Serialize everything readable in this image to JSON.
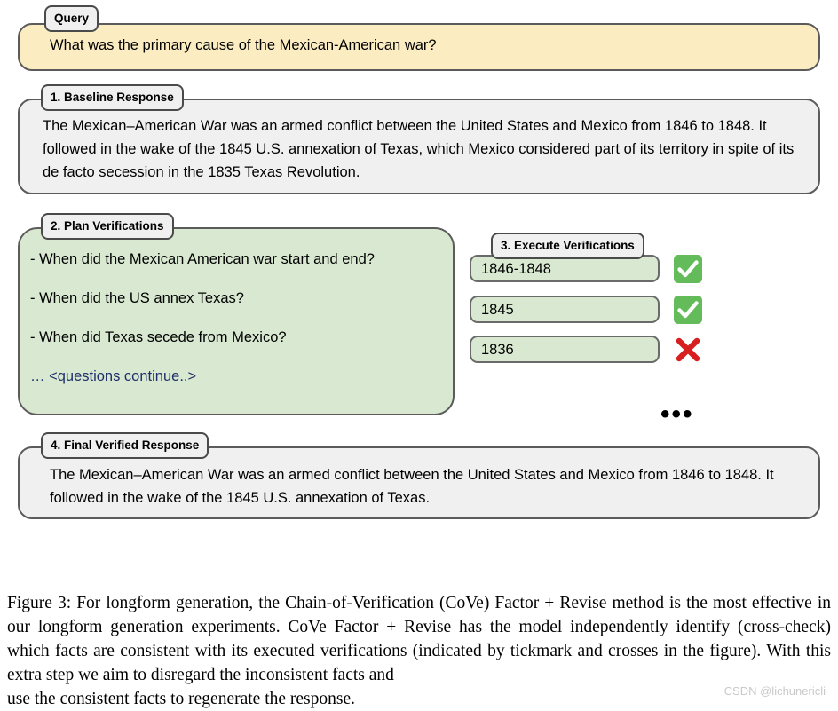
{
  "figure": {
    "query": {
      "tab_label": "Query",
      "text": "What was the primary cause of the Mexican-American war?",
      "fill_color": "#fbecc2"
    },
    "baseline": {
      "tab_label": "1. Baseline Response",
      "text": "The Mexican–American War was an armed conflict between the United States and Mexico from 1846 to 1848. It followed in the wake of the 1845 U.S. annexation of Texas, which Mexico considered part of its territory in spite of its de facto secession in the 1835 Texas Revolution.",
      "fill_color": "#f0f0f0"
    },
    "plan": {
      "tab_label": "2. Plan Verifications",
      "fill_color": "#d9e9d1",
      "questions": [
        "- When did the Mexican American war start and end?",
        "- When did the US annex Texas?",
        "- When did Texas secede from Mexico?"
      ],
      "continuation": "… <questions continue..>",
      "continuation_color": "#1f2f6b"
    },
    "execute": {
      "tab_label": "3. Execute Verifications",
      "fill_color": "#d9e9d1",
      "answers": [
        {
          "value": "1846-1848",
          "verdict": "check",
          "verdict_icon": "green-check-icon"
        },
        {
          "value": "1845",
          "verdict": "check",
          "verdict_icon": "green-check-icon"
        },
        {
          "value": "1836",
          "verdict": "cross",
          "verdict_icon": "red-cross-icon"
        }
      ],
      "check_color": "#63bb5a",
      "cross_color": "#d81f1f",
      "ellipsis": "•••"
    },
    "final": {
      "tab_label": "4. Final Verified Response",
      "text": "The Mexican–American War was an armed conflict between the United States and Mexico from 1846 to 1848. It followed in the wake of the 1845 U.S. annexation of Texas.",
      "fill_color": "#f0f0f0"
    },
    "caption": {
      "body": "Figure 3: For longform generation, the Chain-of-Verification (CoVe) Factor + Revise method is the most effective in our longform generation experiments. CoVe Factor + Revise has the model independently identify (cross-check) which facts are consistent with its executed verifications (indicated by tickmark and crosses in the figure). With this extra step we aim to disregard the inconsistent facts and",
      "last_line": "use the consistent facts to regenerate the response."
    },
    "watermark": "CSDN @lichunericli"
  }
}
